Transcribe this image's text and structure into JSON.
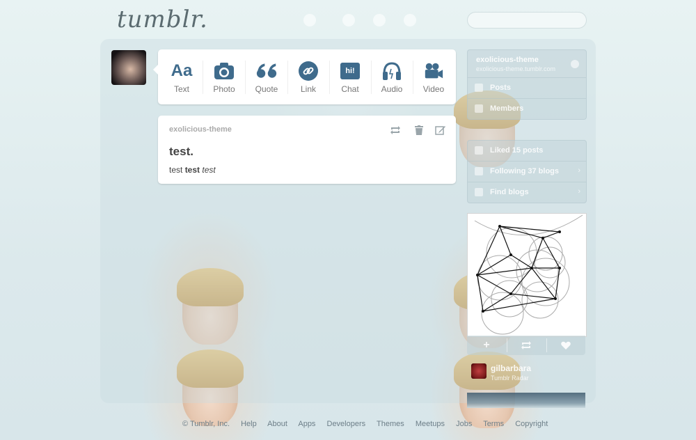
{
  "app": {
    "logo": "tumblr."
  },
  "post_types": [
    {
      "label": "Text",
      "icon": "text-icon"
    },
    {
      "label": "Photo",
      "icon": "camera-icon"
    },
    {
      "label": "Quote",
      "icon": "quote-icon"
    },
    {
      "label": "Link",
      "icon": "link-icon"
    },
    {
      "label": "Chat",
      "icon": "chat-icon"
    },
    {
      "label": "Audio",
      "icon": "headphones-icon"
    },
    {
      "label": "Video",
      "icon": "video-camera-icon"
    }
  ],
  "post_type_icon_text": {
    "text": "Aa",
    "chat": "hi!"
  },
  "post": {
    "author": "exolicious-theme",
    "title": "test.",
    "body_plain1": "test ",
    "body_bold": "test",
    "body_plain2": " ",
    "body_italic": "test"
  },
  "sidebar": {
    "blog": {
      "name": "exolicious-theme",
      "url": "exolicious-theme.tumblr.com"
    },
    "blog_items": [
      "Posts",
      "Members"
    ],
    "account_items": [
      "Liked 15 posts",
      "Following 37 blogs",
      "Find blogs"
    ]
  },
  "radar": {
    "author": "gilbarbara",
    "caption": "Tumblr Radar"
  },
  "footer": {
    "copyright": "© Tumblr, Inc.",
    "links": [
      "Help",
      "About",
      "Apps",
      "Developers",
      "Themes",
      "Meetups",
      "Jobs",
      "Terms",
      "Copyright"
    ]
  },
  "colors": {
    "accent": "#3f6b8c",
    "post_bg": "#ffffff"
  }
}
